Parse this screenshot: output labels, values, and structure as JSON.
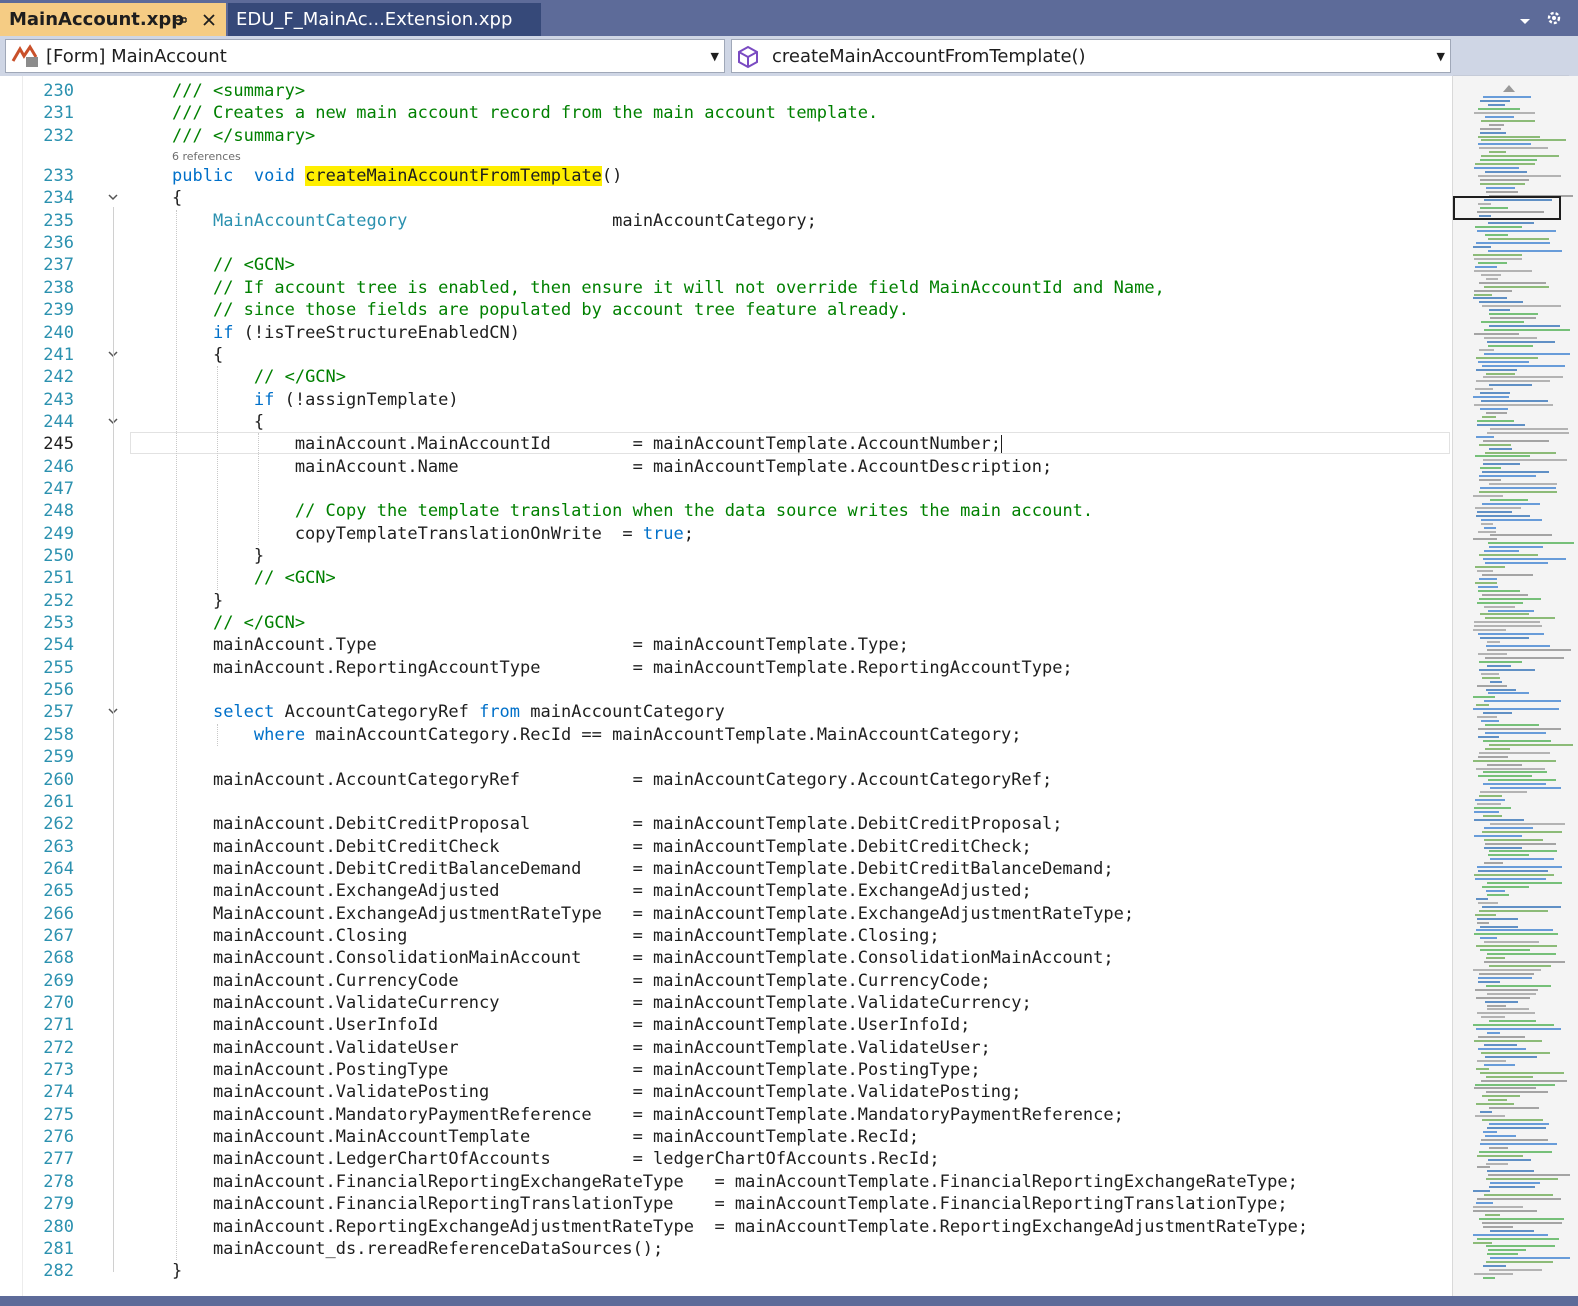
{
  "tabs": [
    {
      "label": "MainAccount.xpp",
      "active": true
    },
    {
      "label": "EDU_F_MainAc...Extension.xpp",
      "active": false
    }
  ],
  "navbar": {
    "left_combo": "[Form] MainAccount",
    "right_combo": "createMainAccountFromTemplate()"
  },
  "codelens": "6 references",
  "colors": {
    "keyword": "#0070c9",
    "type": "#2b91af",
    "comment": "#008000",
    "highlight": "#ffef00",
    "tab_active": "#f5cc84",
    "chrome": "#5d6b99"
  },
  "current_line": 245,
  "lines": [
    {
      "n": 230,
      "tokens": [
        [
          "cm",
          "/// <summary>"
        ]
      ]
    },
    {
      "n": 231,
      "tokens": [
        [
          "cm",
          "/// Creates a new main account record from the main account template."
        ]
      ]
    },
    {
      "n": 232,
      "tokens": [
        [
          "cm",
          "/// </summary>"
        ]
      ]
    },
    {
      "n": 233,
      "tokens": [
        [
          "kw",
          "public"
        ],
        [
          "",
          "  "
        ],
        [
          "kw",
          "void"
        ],
        [
          "",
          " "
        ],
        [
          "hl",
          "createMainAccountFromTemplate"
        ],
        [
          "",
          "()"
        ]
      ]
    },
    {
      "n": 234,
      "tokens": [
        [
          "",
          "{"
        ]
      ]
    },
    {
      "n": 235,
      "tokens": [
        [
          "",
          "    "
        ],
        [
          "ty",
          "MainAccountCategory"
        ],
        [
          "",
          "                    mainAccountCategory;"
        ]
      ]
    },
    {
      "n": 236,
      "tokens": []
    },
    {
      "n": 237,
      "tokens": [
        [
          "",
          "    "
        ],
        [
          "cm",
          "// <GCN>"
        ]
      ]
    },
    {
      "n": 238,
      "tokens": [
        [
          "",
          "    "
        ],
        [
          "cm",
          "// If account tree is enabled, then ensure it will not override field MainAccountId and Name,"
        ]
      ]
    },
    {
      "n": 239,
      "tokens": [
        [
          "",
          "    "
        ],
        [
          "cm",
          "// since those fields are populated by account tree feature already."
        ]
      ]
    },
    {
      "n": 240,
      "tokens": [
        [
          "",
          "    "
        ],
        [
          "kw",
          "if"
        ],
        [
          "",
          " (!isTreeStructureEnabledCN)"
        ]
      ]
    },
    {
      "n": 241,
      "tokens": [
        [
          "",
          "    {"
        ]
      ]
    },
    {
      "n": 242,
      "tokens": [
        [
          "",
          "        "
        ],
        [
          "cm",
          "// </GCN>"
        ]
      ]
    },
    {
      "n": 243,
      "tokens": [
        [
          "",
          "        "
        ],
        [
          "kw",
          "if"
        ],
        [
          "",
          " (!assignTemplate)"
        ]
      ]
    },
    {
      "n": 244,
      "tokens": [
        [
          "",
          "        {"
        ]
      ]
    },
    {
      "n": 245,
      "tokens": [
        [
          "",
          "            mainAccount.MainAccountId        = mainAccountTemplate.AccountNumber;"
        ]
      ]
    },
    {
      "n": 246,
      "tokens": [
        [
          "",
          "            mainAccount.Name                 = mainAccountTemplate.AccountDescription;"
        ]
      ]
    },
    {
      "n": 247,
      "tokens": []
    },
    {
      "n": 248,
      "tokens": [
        [
          "",
          "            "
        ],
        [
          "cm",
          "// Copy the template translation when the data source writes the main account."
        ]
      ]
    },
    {
      "n": 249,
      "tokens": [
        [
          "",
          "            copyTemplateTranslationOnWrite  = "
        ],
        [
          "kw",
          "true"
        ],
        [
          "",
          ";"
        ]
      ]
    },
    {
      "n": 250,
      "tokens": [
        [
          "",
          "        }"
        ]
      ]
    },
    {
      "n": 251,
      "tokens": [
        [
          "",
          "        "
        ],
        [
          "cm",
          "// <GCN>"
        ]
      ]
    },
    {
      "n": 252,
      "tokens": [
        [
          "",
          "    }"
        ]
      ]
    },
    {
      "n": 253,
      "tokens": [
        [
          "",
          "    "
        ],
        [
          "cm",
          "// </GCN>"
        ]
      ]
    },
    {
      "n": 254,
      "tokens": [
        [
          "",
          "    mainAccount.Type                         = mainAccountTemplate.Type;"
        ]
      ]
    },
    {
      "n": 255,
      "tokens": [
        [
          "",
          "    mainAccount.ReportingAccountType         = mainAccountTemplate.ReportingAccountType;"
        ]
      ]
    },
    {
      "n": 256,
      "tokens": []
    },
    {
      "n": 257,
      "tokens": [
        [
          "",
          "    "
        ],
        [
          "kw",
          "select"
        ],
        [
          "",
          " AccountCategoryRef "
        ],
        [
          "kw",
          "from"
        ],
        [
          "",
          " mainAccountCategory"
        ]
      ]
    },
    {
      "n": 258,
      "tokens": [
        [
          "",
          "        "
        ],
        [
          "kw",
          "where"
        ],
        [
          "",
          " mainAccountCategory.RecId == mainAccountTemplate.MainAccountCategory;"
        ]
      ]
    },
    {
      "n": 259,
      "tokens": []
    },
    {
      "n": 260,
      "tokens": [
        [
          "",
          "    mainAccount.AccountCategoryRef           = mainAccountCategory.AccountCategoryRef;"
        ]
      ]
    },
    {
      "n": 261,
      "tokens": []
    },
    {
      "n": 262,
      "tokens": [
        [
          "",
          "    mainAccount.DebitCreditProposal          = mainAccountTemplate.DebitCreditProposal;"
        ]
      ]
    },
    {
      "n": 263,
      "tokens": [
        [
          "",
          "    mainAccount.DebitCreditCheck             = mainAccountTemplate.DebitCreditCheck;"
        ]
      ]
    },
    {
      "n": 264,
      "tokens": [
        [
          "",
          "    mainAccount.DebitCreditBalanceDemand     = mainAccountTemplate.DebitCreditBalanceDemand;"
        ]
      ]
    },
    {
      "n": 265,
      "tokens": [
        [
          "",
          "    mainAccount.ExchangeAdjusted             = mainAccountTemplate.ExchangeAdjusted;"
        ]
      ]
    },
    {
      "n": 266,
      "tokens": [
        [
          "",
          "    MainAccount.ExchangeAdjustmentRateType   = mainAccountTemplate.ExchangeAdjustmentRateType;"
        ]
      ]
    },
    {
      "n": 267,
      "tokens": [
        [
          "",
          "    mainAccount.Closing                      = mainAccountTemplate.Closing;"
        ]
      ]
    },
    {
      "n": 268,
      "tokens": [
        [
          "",
          "    mainAccount.ConsolidationMainAccount     = mainAccountTemplate.ConsolidationMainAccount;"
        ]
      ]
    },
    {
      "n": 269,
      "tokens": [
        [
          "",
          "    mainAccount.CurrencyCode                 = mainAccountTemplate.CurrencyCode;"
        ]
      ]
    },
    {
      "n": 270,
      "tokens": [
        [
          "",
          "    mainAccount.ValidateCurrency             = mainAccountTemplate.ValidateCurrency;"
        ]
      ]
    },
    {
      "n": 271,
      "tokens": [
        [
          "",
          "    mainAccount.UserInfoId                   = mainAccountTemplate.UserInfoId;"
        ]
      ]
    },
    {
      "n": 272,
      "tokens": [
        [
          "",
          "    mainAccount.ValidateUser                 = mainAccountTemplate.ValidateUser;"
        ]
      ]
    },
    {
      "n": 273,
      "tokens": [
        [
          "",
          "    mainAccount.PostingType                  = mainAccountTemplate.PostingType;"
        ]
      ]
    },
    {
      "n": 274,
      "tokens": [
        [
          "",
          "    mainAccount.ValidatePosting              = mainAccountTemplate.ValidatePosting;"
        ]
      ]
    },
    {
      "n": 275,
      "tokens": [
        [
          "",
          "    mainAccount.MandatoryPaymentReference    = mainAccountTemplate.MandatoryPaymentReference;"
        ]
      ]
    },
    {
      "n": 276,
      "tokens": [
        [
          "",
          "    mainAccount.MainAccountTemplate          = mainAccountTemplate.RecId;"
        ]
      ]
    },
    {
      "n": 277,
      "tokens": [
        [
          "",
          "    mainAccount.LedgerChartOfAccounts        = ledgerChartOfAccounts.RecId;"
        ]
      ]
    },
    {
      "n": 278,
      "tokens": [
        [
          "",
          "    mainAccount.FinancialReportingExchangeRateType   = mainAccountTemplate.FinancialReportingExchangeRateType;"
        ]
      ]
    },
    {
      "n": 279,
      "tokens": [
        [
          "",
          "    mainAccount.FinancialReportingTranslationType    = mainAccountTemplate.FinancialReportingTranslationType;"
        ]
      ]
    },
    {
      "n": 280,
      "tokens": [
        [
          "",
          "    mainAccount.ReportingExchangeAdjustmentRateType  = mainAccountTemplate.ReportingExchangeAdjustmentRateType;"
        ]
      ]
    },
    {
      "n": 281,
      "tokens": [
        [
          "",
          "    mainAccount_ds.rereadReferenceDataSources();"
        ]
      ]
    },
    {
      "n": 282,
      "tokens": [
        [
          "",
          "}"
        ]
      ]
    }
  ],
  "fold_lines": [
    234,
    241,
    244,
    257
  ]
}
